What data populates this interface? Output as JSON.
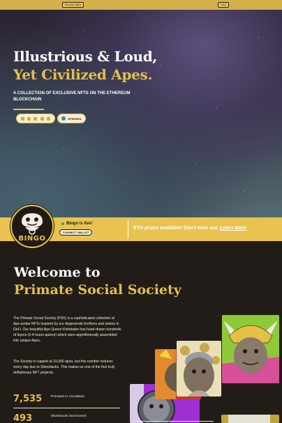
{
  "topbar": {
    "left_button": "Browse Apes",
    "right_button": "FAQ"
  },
  "hero": {
    "title_line1": "Illustrious & Loud,",
    "title_line2": "Yet Civilized Apes.",
    "subtitle": "A COLLECTION OF EXCLUSIVE NFTs ON THE ETHEREUM BLOCKCHAIN",
    "social_icons": [
      "twitter-icon",
      "discord-icon",
      "instagram-icon",
      "telegram-icon",
      "reddit-icon"
    ],
    "opensea_label": "OPENSEA"
  },
  "band": {
    "logo_text": "BINGO",
    "live_text": "Bingo is live!",
    "connect_label": "CONNECT WALLET",
    "prize_text": "ETH prizes available! Don't miss out.",
    "prize_link": "Learn More",
    "colors": {
      "band": "#e8c350",
      "accent": "#e5bf4c",
      "live_dot": "#39a845"
    }
  },
  "about": {
    "heading_line1": "Welcome to",
    "heading_line2": "Primate Social Society",
    "paragraph1": "The Primate Social Society (PSS) is a sophisticated collection of Ape avatar NFTs inspired by our degenerate brothers and sisters in DeFi. Our beautiful Ape Queen Knifebabe has hand-drawn hundreds of layers (2-4 hours apiece) which were algorithmically assembled into unique Apes.",
    "paragraph2": "The Society is capped at 10,000 apes, but this number reduces every day due to Silverbacks. This makes us one of the first truly deflationary NFT projects.",
    "stats": [
      {
        "value": "7,535",
        "label": "Primates in Circulation"
      },
      {
        "value": "493",
        "label": "Silverbacks Summoned"
      }
    ]
  }
}
